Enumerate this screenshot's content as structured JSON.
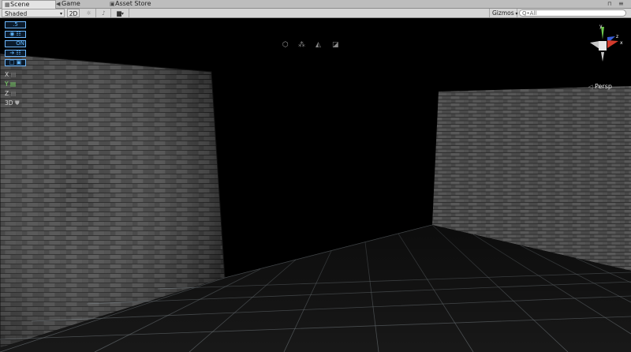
{
  "tabs": [
    {
      "label": "Scene",
      "icon": "scene-icon",
      "glyph": "▦"
    },
    {
      "label": "Game",
      "icon": "game-icon",
      "glyph": "◀"
    },
    {
      "label": "Asset Store",
      "icon": "store-icon",
      "glyph": "▣"
    }
  ],
  "toolbar": {
    "shading_mode": "Shaded",
    "mode_2d": "2D",
    "gizmos_label": "Gizmos",
    "search_placeholder": "All",
    "search_prefix": "Q•"
  },
  "overlay": {
    "items": [
      {
        "label": ".5",
        "icon": "snap-value-icon"
      },
      {
        "label": "◉ ☷",
        "icon": "eye-grid-icon"
      },
      {
        "label": "ON",
        "icon": "toggle-on-icon"
      },
      {
        "label": "➔ ☷",
        "icon": "move-grid-icon"
      },
      {
        "label": "□ ▣",
        "icon": "lock-icon"
      }
    ],
    "axes": [
      {
        "label": "X",
        "color": "#cfcfcf"
      },
      {
        "label": "Y",
        "color": "#7ee36a"
      },
      {
        "label": "Z",
        "color": "#cfcfcf"
      },
      {
        "label": "3D",
        "color": "#cfcfcf"
      }
    ]
  },
  "gizmo": {
    "projection": "Persp",
    "axis_y": "y",
    "axis_z": "z",
    "axis_x": "x",
    "colors": {
      "x": "#d33b2c",
      "y": "#6cc44a",
      "z": "#3a5fd8"
    }
  }
}
